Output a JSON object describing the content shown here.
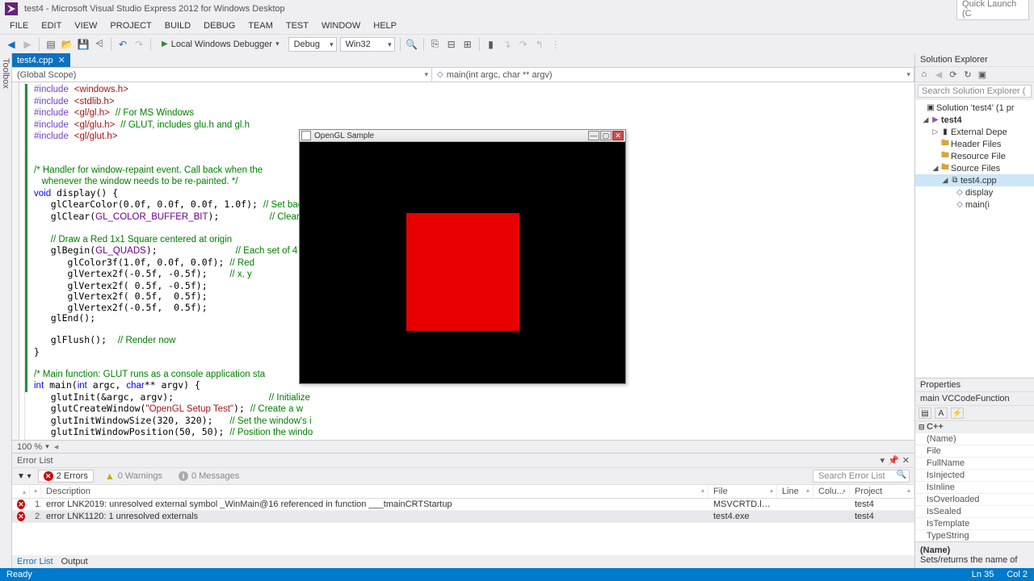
{
  "titlebar": {
    "text": "test4 - Microsoft Visual Studio Express 2012 for Windows Desktop",
    "quick_launch": "Quick Launch (C"
  },
  "menu": [
    "FILE",
    "EDIT",
    "VIEW",
    "PROJECT",
    "BUILD",
    "DEBUG",
    "TEAM",
    "TEST",
    "WINDOW",
    "HELP"
  ],
  "toolbar": {
    "debugger": "Local Windows Debugger",
    "config": "Debug",
    "platform": "Win32"
  },
  "doc_tab": {
    "name": "test4.cpp"
  },
  "scope": {
    "left": "(Global Scope)",
    "right": "main(int argc, char ** argv)"
  },
  "zoom": "100 %",
  "gl_window": {
    "title": "OpenGL Sample"
  },
  "error_list": {
    "title": "Error List",
    "filters": {
      "errors": "2 Errors",
      "warnings": "0 Warnings",
      "messages": "0 Messages"
    },
    "search_placeholder": "Search Error List",
    "columns": {
      "desc": "Description",
      "file": "File",
      "line": "Line",
      "col": "Colu...",
      "proj": "Project"
    },
    "rows": [
      {
        "n": "1",
        "desc": "error LNK2019: unresolved external symbol _WinMain@16 referenced in function ___tmainCRTStartup",
        "file": "MSVCRTD.lib(crtexew.",
        "line": "",
        "col": "",
        "proj": "test4"
      },
      {
        "n": "2",
        "desc": "error LNK1120: 1 unresolved externals",
        "file": "test4.exe",
        "line": "",
        "col": "",
        "proj": "test4"
      }
    ]
  },
  "bottom_tabs": [
    "Error List",
    "Output"
  ],
  "solution_explorer": {
    "title": "Solution Explorer",
    "search_placeholder": "Search Solution Explorer (",
    "solution": "Solution 'test4' (1 pr",
    "project": "test4",
    "folders": {
      "ext": "External Depe",
      "hdr": "Header Files",
      "res": "Resource File",
      "src": "Source Files"
    },
    "file": "test4.cpp",
    "funcs": [
      "display",
      "main(i"
    ]
  },
  "properties": {
    "title": "Properties",
    "subject": "main  VCCodeFunction",
    "category": "C++",
    "rows": [
      "(Name)",
      "File",
      "FullName",
      "IsInjected",
      "IsInline",
      "IsOverloaded",
      "IsSealed",
      "IsTemplate",
      "TypeString"
    ],
    "desc_name": "(Name)",
    "desc_text": "Sets/returns the name of"
  },
  "statusbar": {
    "left": "Ready",
    "ln": "Ln 35",
    "col": "Col 2"
  }
}
